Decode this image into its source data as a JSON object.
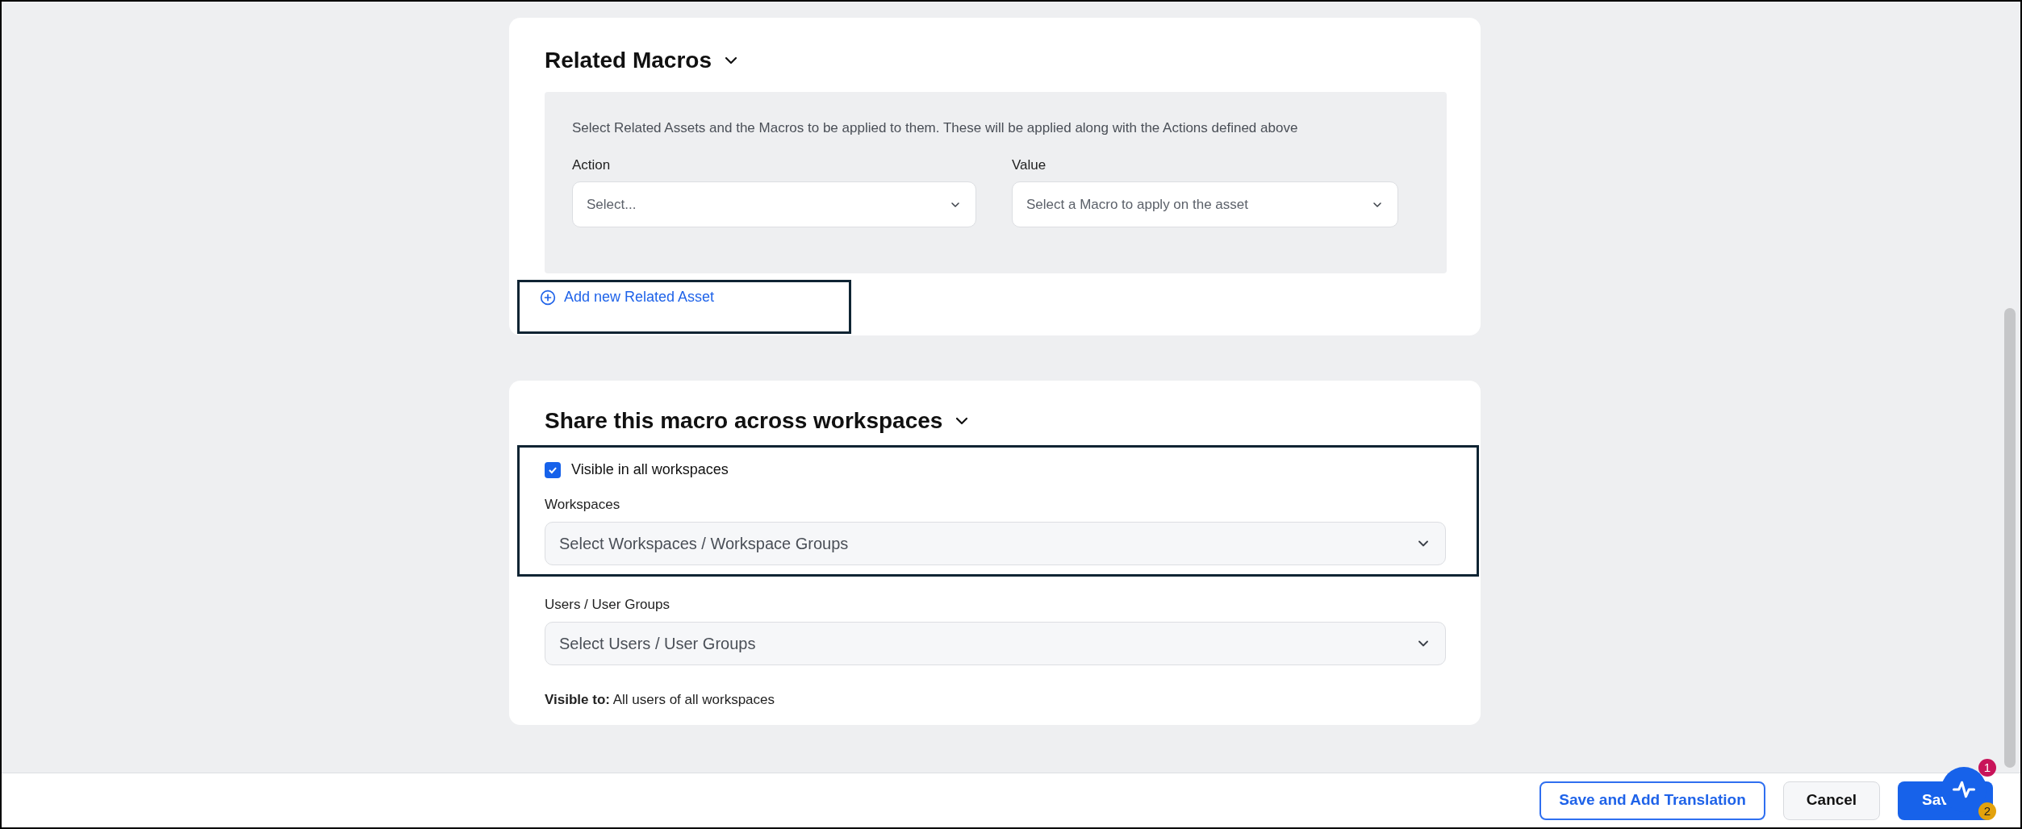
{
  "related_macros": {
    "title": "Related Macros",
    "expanded": true,
    "description": "Select Related Assets and the Macros to be applied to them. These will be applied along with the Actions defined above",
    "fields": [
      {
        "label": "Action",
        "placeholder": "Select..."
      },
      {
        "label": "Value",
        "placeholder": "Select a Macro to apply on the asset"
      }
    ],
    "add_link": "Add new Related Asset"
  },
  "share": {
    "title": "Share this macro across workspaces",
    "expanded": true,
    "checkbox": {
      "label": "Visible in all workspaces",
      "checked": true
    },
    "fields": [
      {
        "label": "Workspaces",
        "placeholder": "Select Workspaces / Workspace Groups"
      },
      {
        "label": "Users / User Groups",
        "placeholder": "Select Users / User Groups"
      }
    ],
    "visible_to": "**Visible to:** All users of all workspaces"
  },
  "footer": {
    "buttons": [
      {
        "label": "Save and Add Translation",
        "kind": "outline"
      },
      {
        "label": "Cancel",
        "kind": "secondary"
      },
      {
        "label": "Sav",
        "kind": "primary"
      }
    ]
  },
  "widget": {
    "badges": [
      "1",
      "2"
    ]
  }
}
